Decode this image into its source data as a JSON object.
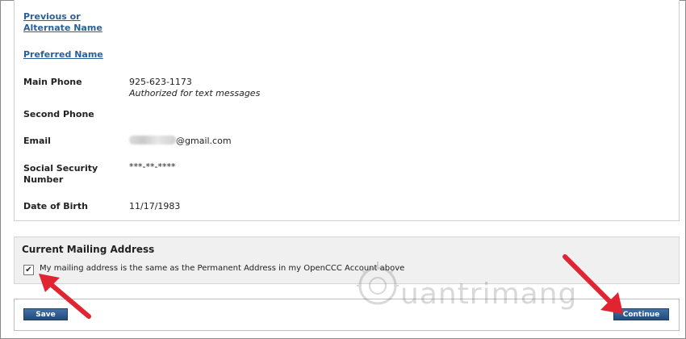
{
  "links": {
    "previous_name": "Previous or Alternate Name",
    "preferred_name": "Preferred Name"
  },
  "fields": {
    "main_phone": {
      "label": "Main Phone",
      "value": "925-623-1173",
      "note": "Authorized for text messages"
    },
    "second_phone": {
      "label": "Second Phone",
      "value": ""
    },
    "email": {
      "label": "Email",
      "value": "@gmail.com"
    },
    "ssn": {
      "label": "Social Security Number",
      "value": "***-**-****"
    },
    "dob": {
      "label": "Date of Birth",
      "value": "11/17/1983"
    }
  },
  "mailing": {
    "title": "Current Mailing Address",
    "checkbox_checked": true,
    "checkbox_label": "My mailing address is the same as the Permanent Address in my OpenCCC Account above"
  },
  "buttons": {
    "save": "Save",
    "continue": "Continue"
  },
  "watermark": {
    "text": "uantrimang"
  },
  "colors": {
    "link": "#2a5f9e",
    "button": "#2f5d91",
    "arrow": "#e02430"
  }
}
